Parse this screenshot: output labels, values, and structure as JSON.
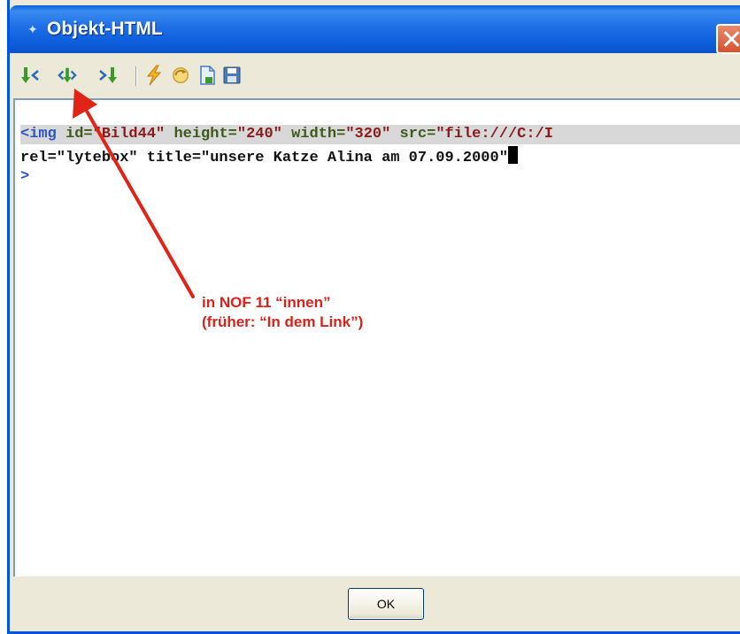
{
  "window": {
    "title": "Objekt-HTML",
    "title_icon": "app-icon"
  },
  "toolbar": {
    "buttons": [
      {
        "name": "insert-before-icon",
        "color": "#3a9a2a"
      },
      {
        "name": "insert-inside-icon",
        "color": "#3a9a2a"
      },
      {
        "name": "insert-after-icon",
        "color": "#3a9a2a"
      },
      {
        "name": "lightning-icon",
        "color": "#f0b020"
      },
      {
        "name": "refresh-icon",
        "color": "#f0b020"
      },
      {
        "name": "document-icon",
        "color": "#4a7ab8"
      },
      {
        "name": "save-icon",
        "color": "#4a7ab8"
      }
    ]
  },
  "editor": {
    "line1": {
      "tag": "<img",
      "attr1": " id=",
      "val1": "\"Bild44\"",
      "attr2": " height=",
      "val2": "\"240\"",
      "attr3": " width=",
      "val3": "\"320\"",
      "attr4": " src=",
      "val4": "\"file:///C:/I"
    },
    "line2": "rel=\"lytebox\" title=\"unsere Katze Alina am 07.09.2000\"",
    "line3": ">"
  },
  "annotation": {
    "line1": "in NOF 11 “innen”",
    "line2": "(früher: “In dem Link”)",
    "color": "#d9231a"
  },
  "footer": {
    "ok_label": "OK"
  }
}
